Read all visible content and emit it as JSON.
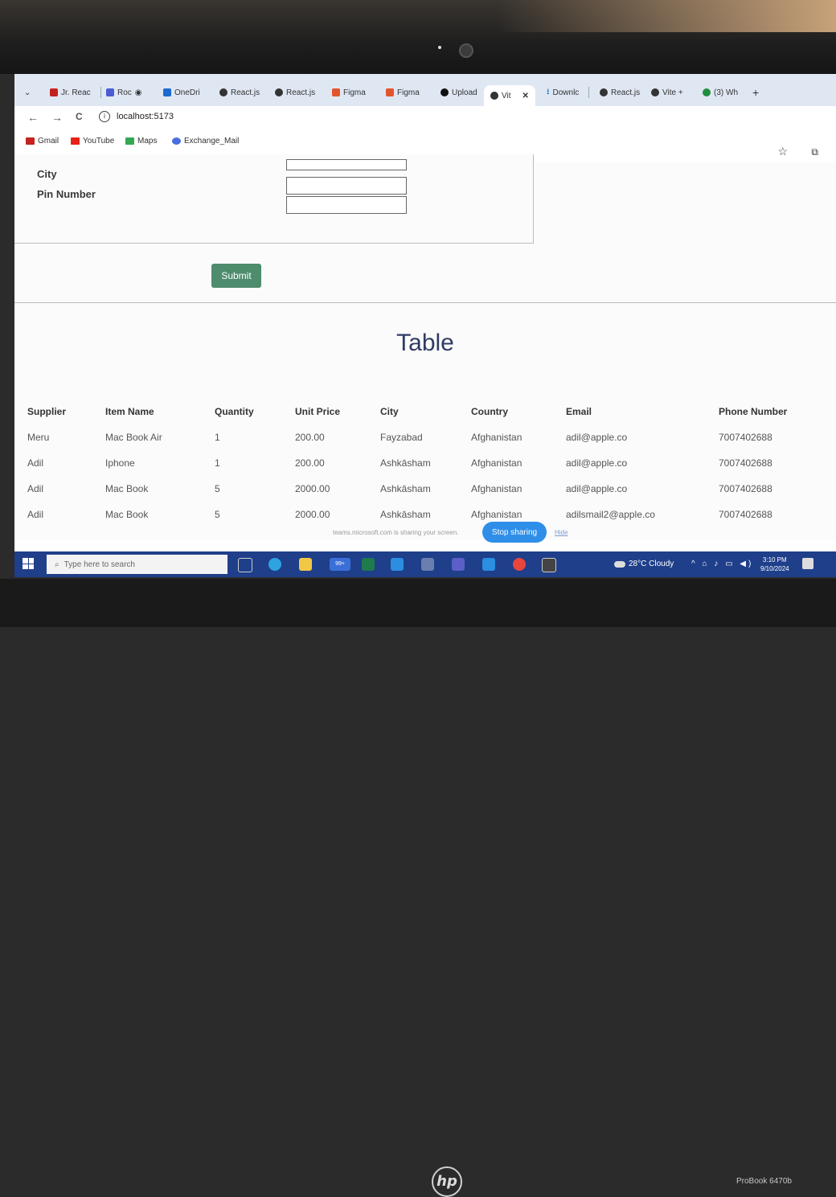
{
  "browser": {
    "tabs": [
      {
        "label": "Jr. Reac",
        "color": "#c5221f"
      },
      {
        "label": "Roc",
        "color": "#4a5bd4"
      },
      {
        "label": "OneDri",
        "color": "#1b6ad0"
      },
      {
        "label": "React.js",
        "color": "#333333"
      },
      {
        "label": "React.js",
        "color": "#333333"
      },
      {
        "label": "Figma",
        "color": "#e2552c"
      },
      {
        "label": "Figma",
        "color": "#e2552c"
      },
      {
        "label": "Upload",
        "color": "#111111"
      },
      {
        "label": "Vit",
        "color": "#333333"
      },
      {
        "label": "Downlc",
        "color": "#1b6ad0"
      },
      {
        "label": "React.js",
        "color": "#333333"
      },
      {
        "label": "Vite +",
        "color": "#333333"
      },
      {
        "label": "(3) Wh",
        "color": "#1e8e3e"
      }
    ],
    "close_glyph": "✕",
    "new_tab_glyph": "+",
    "back_glyph": "←",
    "forward_glyph": "→",
    "reload_glyph": "C",
    "url": "localhost:5173",
    "bookmarks": [
      {
        "label": "Gmail",
        "color": "#c5221f"
      },
      {
        "label": "YouTube",
        "color": "#e62117"
      },
      {
        "label": "Maps",
        "color": "#34a853"
      },
      {
        "label": "Exchange_Mail",
        "color": "#4a6ee0"
      }
    ],
    "star_glyph": "☆",
    "ext_glyph": "⧉"
  },
  "form": {
    "city_label": "City",
    "pin_label": "Pin Number",
    "submit_label": "Submit"
  },
  "table": {
    "title": "Table",
    "headers": [
      "Supplier",
      "Item Name",
      "Quantity",
      "Unit Price",
      "City",
      "Country",
      "Email",
      "Phone Number"
    ],
    "rows": [
      [
        "Meru",
        "Mac Book Air",
        "1",
        "200.00",
        "Fayzabad",
        "Afghanistan",
        "adil@apple.co",
        "7007402688"
      ],
      [
        "Adil",
        "Iphone",
        "1",
        "200.00",
        "Ashkāsham",
        "Afghanistan",
        "adil@apple.co",
        "7007402688"
      ],
      [
        "Adil",
        "Mac Book",
        "5",
        "2000.00",
        "Ashkāsham",
        "Afghanistan",
        "adil@apple.co",
        "7007402688"
      ],
      [
        "Adil",
        "Mac Book",
        "5",
        "2000.00",
        "Ashkāsham",
        "Afghanistan",
        "adilsmail2@apple.co",
        "7007402688"
      ]
    ]
  },
  "share": {
    "text": "teams.microsoft.com is sharing your screen.",
    "stop_label": "Stop sharing",
    "hide_label": "Hide"
  },
  "taskbar": {
    "search_placeholder": "Type here to search",
    "weather": "28°C Cloudy",
    "tray_glyphs": "^ ⌂ ♪ ▭ ◀)",
    "time": "3:10 PM",
    "date": "9/10/2024",
    "mail_badge": "99+"
  },
  "device": {
    "brand": "hp",
    "model": "ProBook 6470b"
  }
}
